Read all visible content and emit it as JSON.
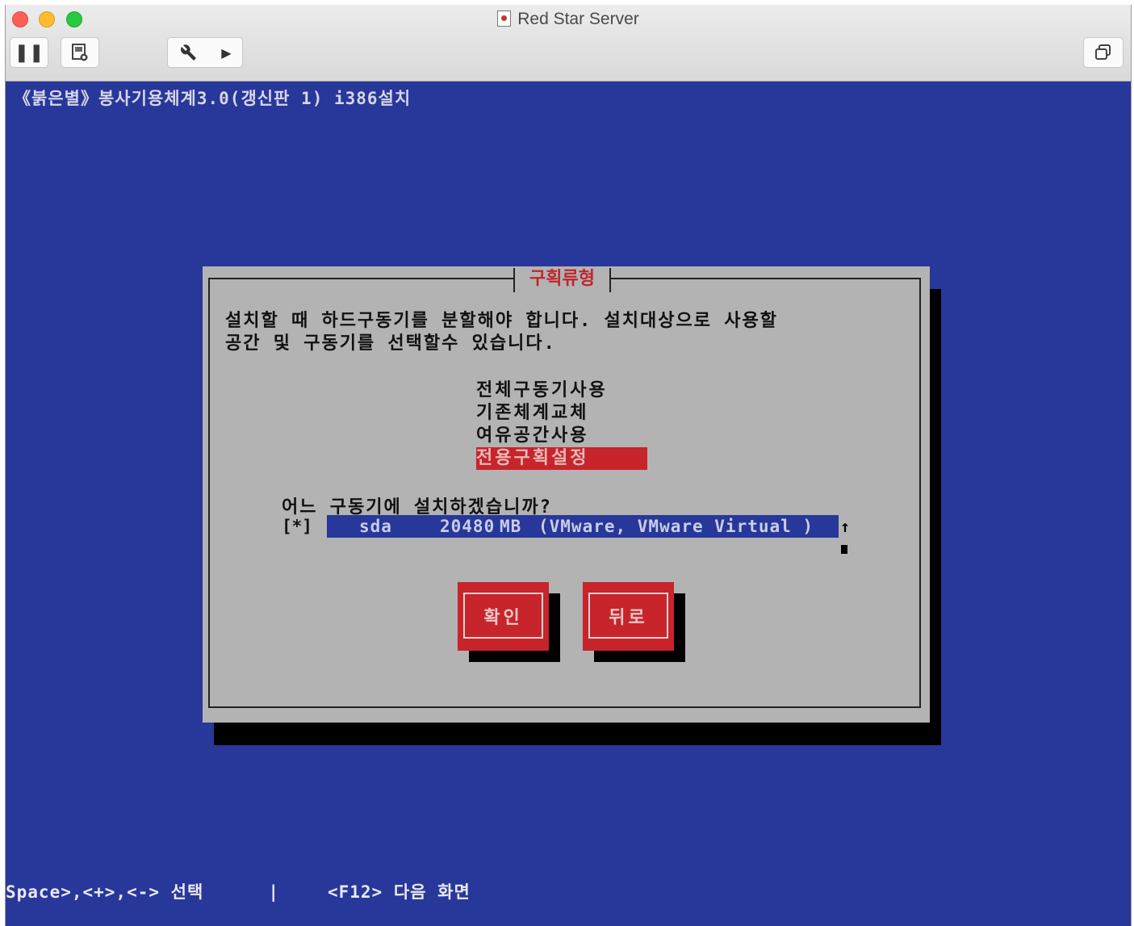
{
  "window": {
    "title": "Red Star Server"
  },
  "toolbar": {
    "pause_icon": "pause-icon",
    "snapshot_icon": "snapshot-icon",
    "tools_icon": "wrench-icon",
    "expand_icon": "play-arrow-icon",
    "restore_icon": "restore-window-icon",
    "pause_glyph": "❚❚",
    "snapshot_glyph": "▤",
    "tools_glyph": "🔧",
    "expand_glyph": "▶",
    "restore_glyph": "⧉"
  },
  "installer": {
    "header": "《붉은별》봉사기용체계3.0(갱신판 1) i386설치",
    "status_keys": "Space>,<+>,<->",
    "status_select": "선택",
    "status_sep": "|",
    "status_f12": "<F12>",
    "status_next": "다음 화면"
  },
  "dialog": {
    "title": "구획류형",
    "text_line1": "설치할 때 하드구동기를 분할해야 합니다. 설치대상으로 사용할",
    "text_line2": "공간 및 구동기를 선택할수 있습니다.",
    "options": [
      {
        "label": "전체구동기사용",
        "selected": false
      },
      {
        "label": "기존체계교체",
        "selected": false
      },
      {
        "label": "여유공간사용",
        "selected": false
      },
      {
        "label": "전용구획설정",
        "selected": true
      }
    ],
    "question": "어느 구동기에 설치하겠습니까?",
    "drive": {
      "checkbox": "[*]",
      "name": "sda",
      "size": "20480",
      "unit": "MB",
      "model": "(VMware, VMware Virtual )",
      "scroll_glyph": "↑"
    },
    "ok_label": "확인",
    "back_label": "뒤로"
  },
  "colors": {
    "console_bg": "#28379a",
    "dialog_bg": "#b3b3b3",
    "accent_red": "#c7242b"
  }
}
